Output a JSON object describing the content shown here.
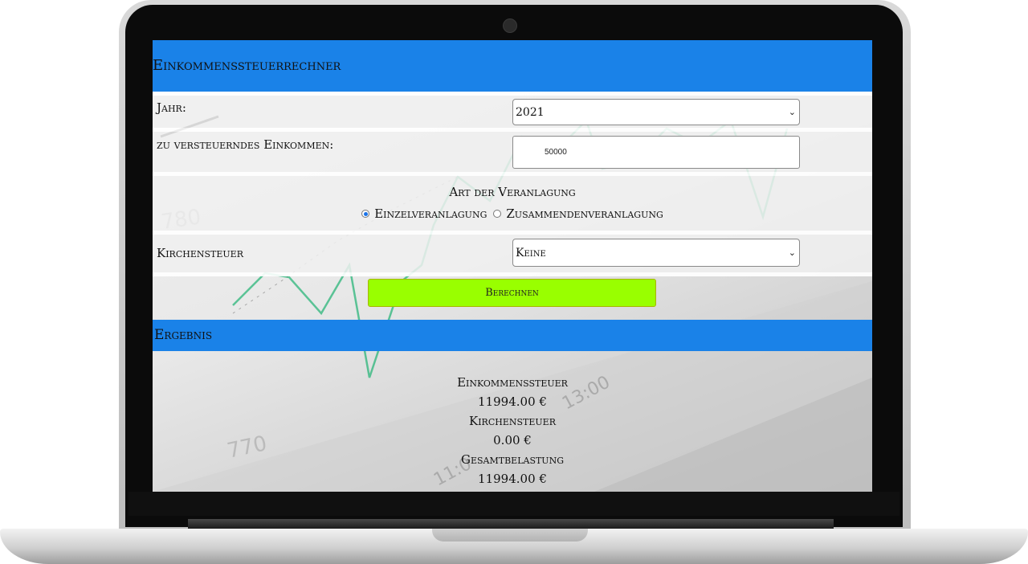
{
  "app": {
    "title": "Einkommenssteuerrechner"
  },
  "form": {
    "jahr_label": "Jahr:",
    "jahr_value": "2021",
    "einkommen_label": "zu versteuerndes Einkommen:",
    "einkommen_value": "50000",
    "veranlagung_title": "Art der Veranlagung",
    "veranlagung_options": [
      {
        "label": "Einzelveranlagung",
        "checked": true
      },
      {
        "label": "Zusammendenveranlagung",
        "checked": false
      }
    ],
    "kirchensteuer_label": "Kirchensteuer",
    "kirchensteuer_value": "Keine",
    "berechnen_label": "Berechnen"
  },
  "result": {
    "title": "Ergebnis",
    "einkommenssteuer_label": "Einkommenssteuer",
    "einkommenssteuer_value": "11994.00 €",
    "kirchensteuer_label": "Kirchensteuer",
    "kirchensteuer_value": "0.00 €",
    "gesamt_label": "Gesamtbelastung",
    "gesamt_value": "11994.00 €"
  },
  "background": {
    "numbers": [
      "780",
      "770",
      "13:00",
      "11:0"
    ]
  },
  "colors": {
    "header_bar": "#1a82e8",
    "button": "#99ff00",
    "chart_line": "#2bb57a"
  }
}
